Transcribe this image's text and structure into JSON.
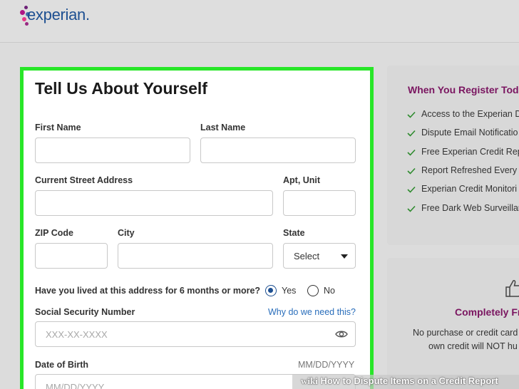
{
  "header": {
    "logo_text": "experian."
  },
  "form": {
    "title": "Tell Us About Yourself",
    "first_name_label": "First Name",
    "last_name_label": "Last Name",
    "street_label": "Current Street Address",
    "apt_label": "Apt, Unit",
    "zip_label": "ZIP Code",
    "city_label": "City",
    "state_label": "State",
    "state_value": "Select",
    "question": "Have you lived at this address for 6 months or more?",
    "yes_label": "Yes",
    "no_label": "No",
    "ssn_label": "Social Security Number",
    "ssn_link": "Why do we need this?",
    "ssn_placeholder": "XXX-XX-XXXX",
    "dob_label": "Date of Birth",
    "dob_format": "MM/DD/YYYY",
    "dob_placeholder": "MM/DD/YYYY"
  },
  "sidebar": {
    "title": "When You Register Toda",
    "benefits": [
      "Access to the Experian D",
      "Dispute Email Notificatio",
      "Free Experian Credit Rep",
      "Report Refreshed Every S",
      "Experian Credit Monitori",
      "Free Dark Web Surveillar"
    ],
    "card2_title": "Completely Fr",
    "card2_line1": "No purchase or credit card",
    "card2_line2": "own credit will NOT hu"
  },
  "watermark": {
    "brand": "wiki",
    "text": "How to Dispute Items on a Credit Report"
  },
  "colors": {
    "accent_green": "#28e628",
    "brand_blue": "#1d4f91",
    "brand_purple": "#7a1560",
    "link_blue": "#2a6ebb"
  }
}
